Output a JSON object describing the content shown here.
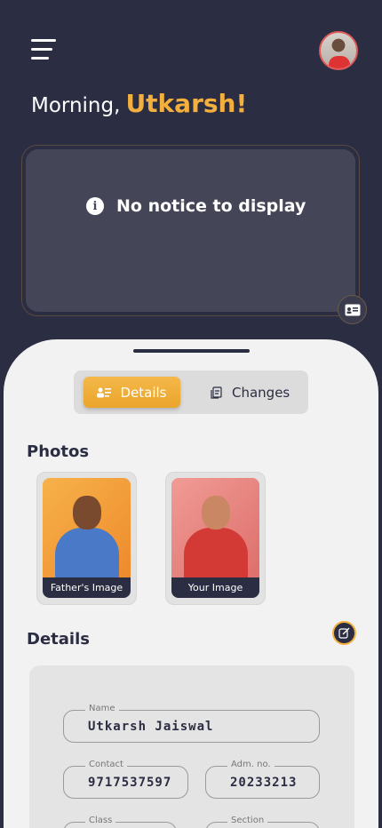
{
  "header": {
    "greeting_prefix": "Morning,",
    "user_name": "Utkarsh!"
  },
  "notice": {
    "text": "No notice to display"
  },
  "tabs": {
    "details_label": "Details",
    "changes_label": "Changes"
  },
  "photos": {
    "title": "Photos",
    "items": [
      {
        "label": "Father's Image"
      },
      {
        "label": "Your Image"
      }
    ]
  },
  "details": {
    "title": "Details",
    "fields": {
      "name": {
        "label": "Name",
        "value": "Utkarsh Jaiswal"
      },
      "contact": {
        "label": "Contact",
        "value": "9717537597"
      },
      "adm_no": {
        "label": "Adm. no.",
        "value": "20233213"
      },
      "class": {
        "label": "Class",
        "value": ""
      },
      "section": {
        "label": "Section",
        "value": ""
      }
    }
  },
  "colors": {
    "background": "#2b2d42",
    "accent": "#f4b03e",
    "sheet": "#f2f2f2"
  }
}
